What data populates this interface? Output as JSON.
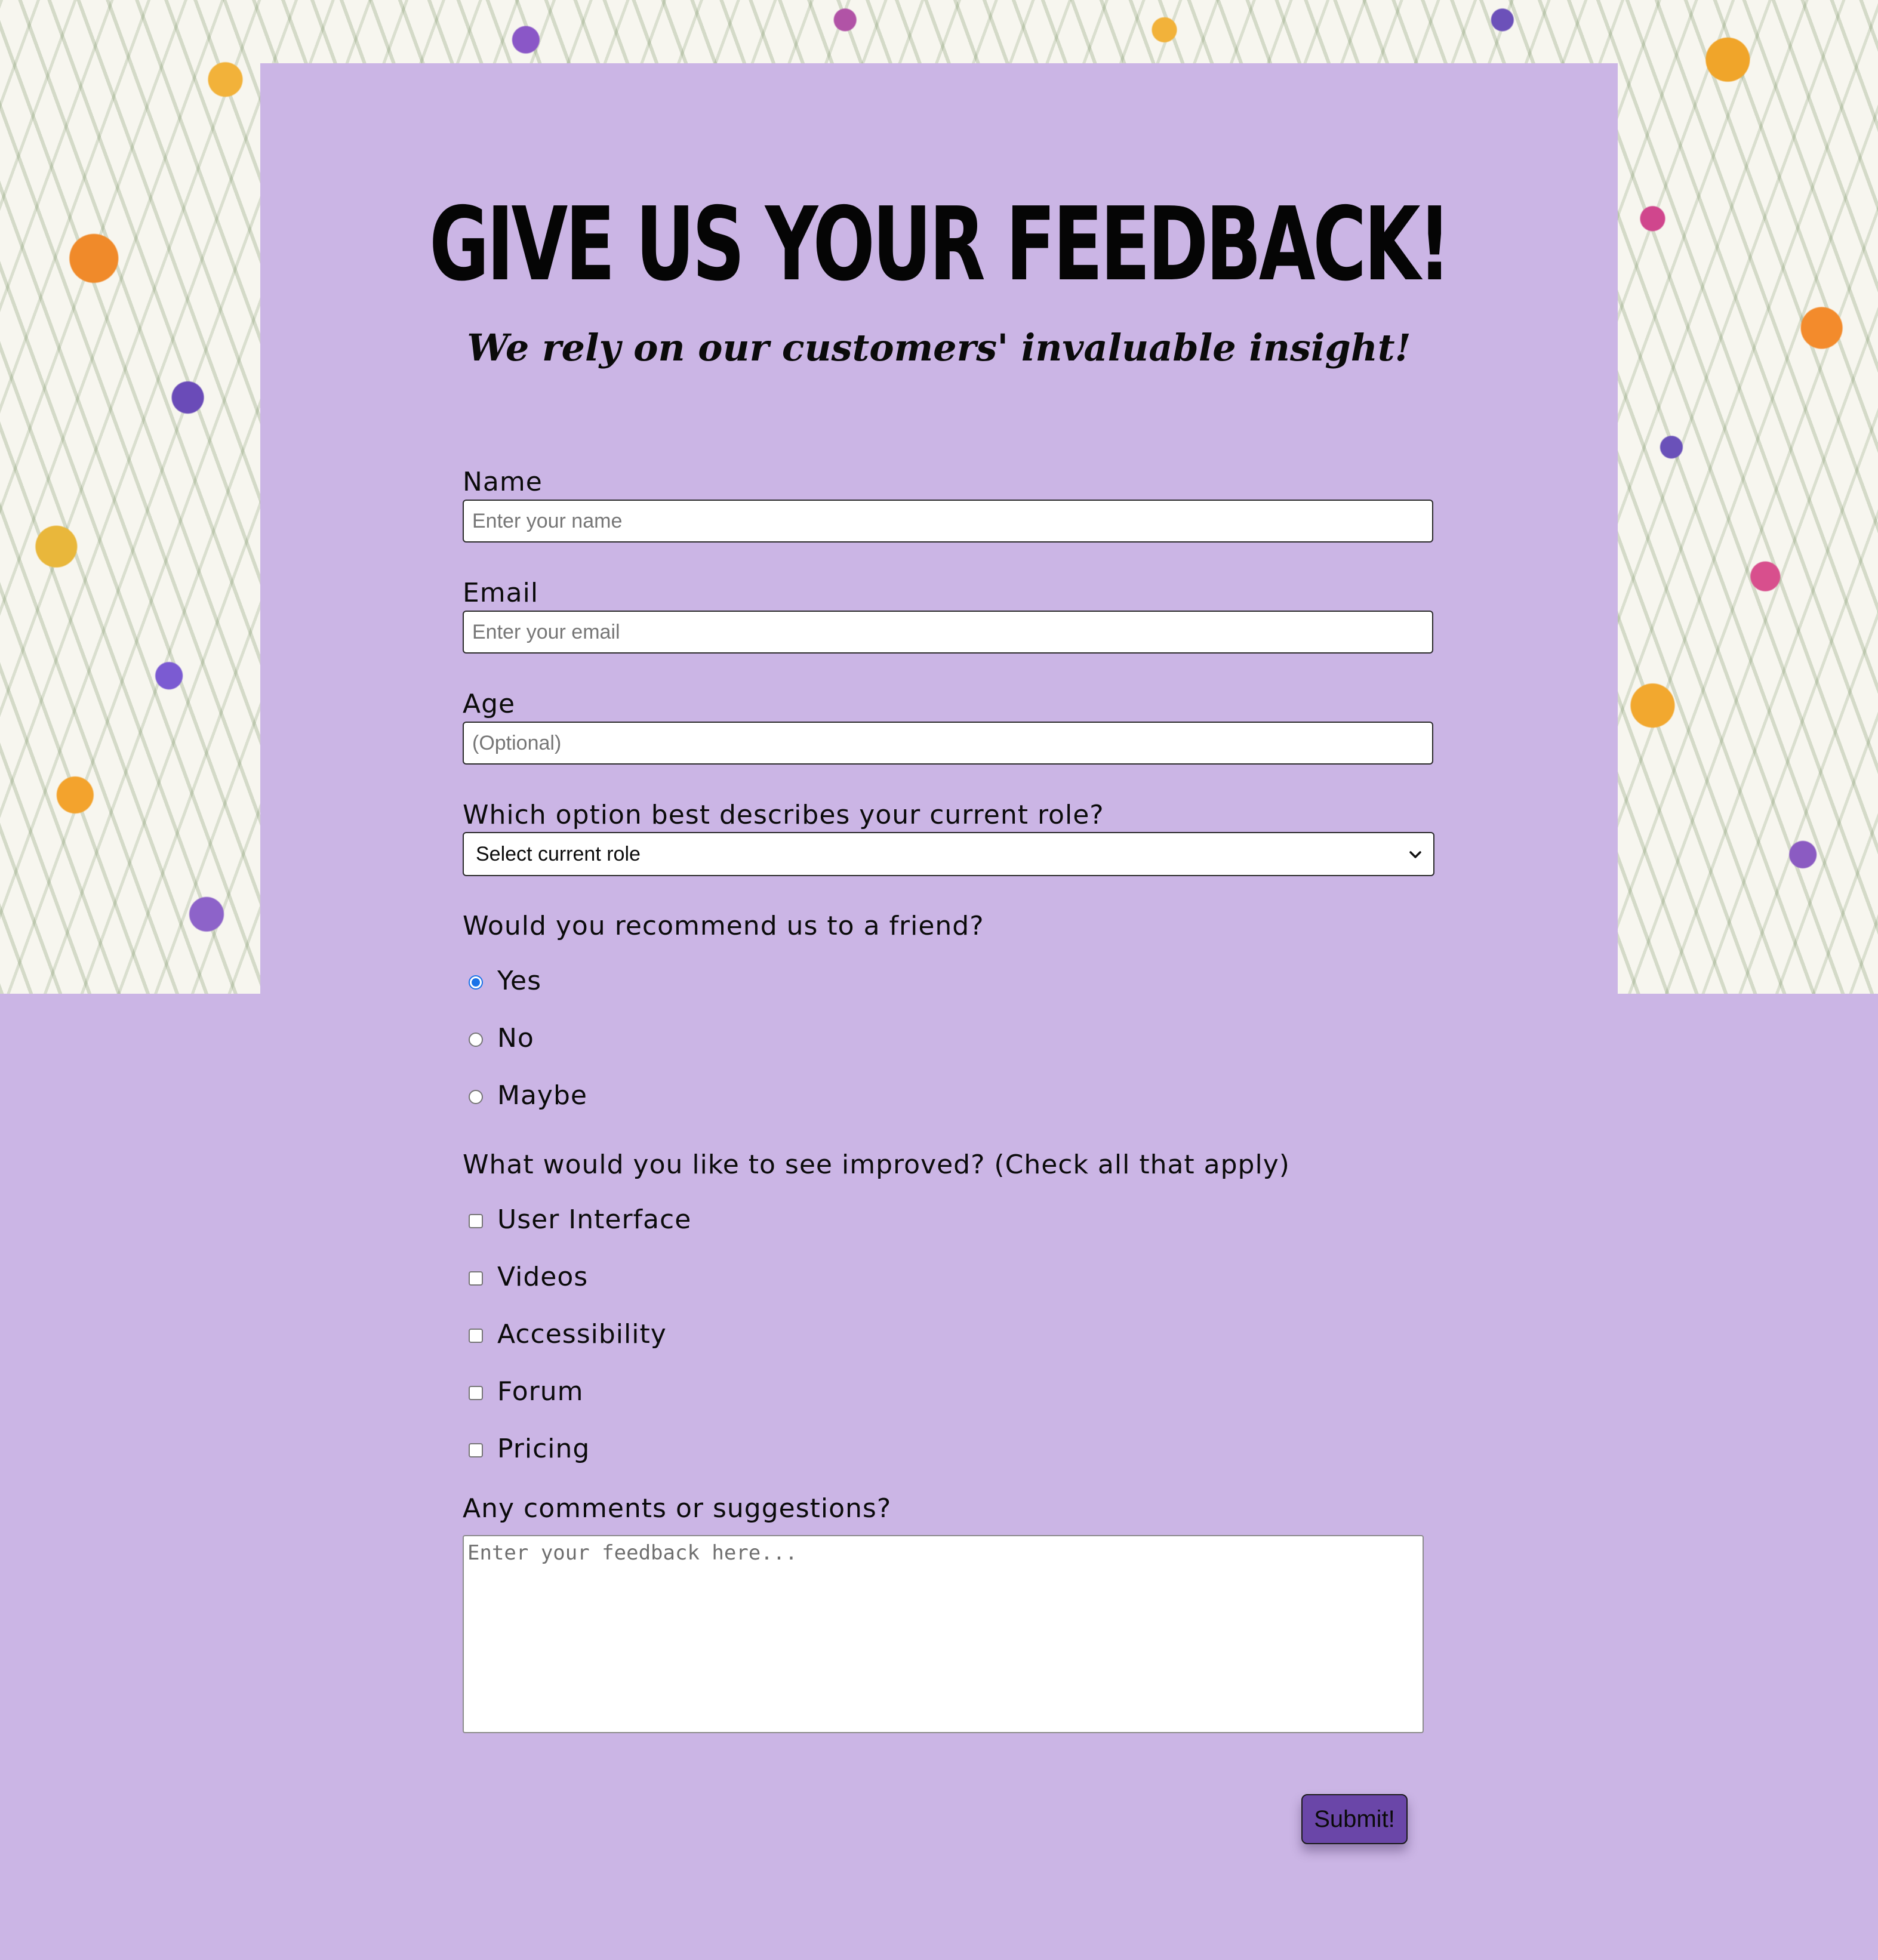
{
  "page": {
    "title": "GIVE US YOUR FEEDBACK!",
    "subtitle": "We rely on our customers' invaluable insight!",
    "background_color": "#cbb5e5",
    "background_image": "floral-pattern"
  },
  "form": {
    "name": {
      "label": "Name",
      "placeholder": "Enter your name",
      "value": ""
    },
    "email": {
      "label": "Email",
      "placeholder": "Enter your email",
      "value": ""
    },
    "age": {
      "label": "Age",
      "placeholder": "(Optional)",
      "value": ""
    },
    "role": {
      "label": "Which option best describes your current role?",
      "selected": "Select current role",
      "icon": "chevron-down-icon"
    },
    "recommend": {
      "question": "Would you recommend us to a friend?",
      "options": [
        {
          "label": "Yes",
          "checked": true
        },
        {
          "label": "No",
          "checked": false
        },
        {
          "label": "Maybe",
          "checked": false
        }
      ]
    },
    "improve": {
      "question": "What would you like to see improved? (Check all that apply)",
      "options": [
        {
          "label": "User Interface",
          "checked": false
        },
        {
          "label": "Videos",
          "checked": false
        },
        {
          "label": "Accessibility",
          "checked": false
        },
        {
          "label": "Forum",
          "checked": false
        },
        {
          "label": "Pricing",
          "checked": false
        }
      ]
    },
    "comments": {
      "label": "Any comments or suggestions?",
      "placeholder": "Enter your feedback here...",
      "value": ""
    },
    "submit_label": "Submit!",
    "submit_color": "#6a46a8",
    "radio_accent": "#1a73e8"
  }
}
